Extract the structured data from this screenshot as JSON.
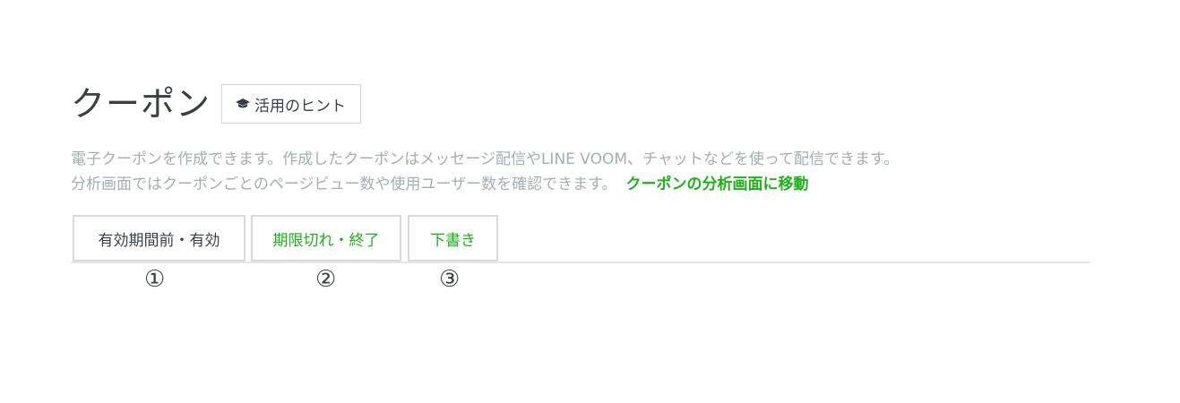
{
  "header": {
    "title": "クーポン",
    "hint_button": {
      "label": "活用のヒント",
      "icon": "graduation-cap-icon"
    }
  },
  "description": {
    "line1": "電子クーポンを作成できます。作成したクーポンはメッセージ配信やLINE VOOM、チャットなどを使って配信できます。",
    "line2": "分析画面ではクーポンごとのページビュー数や使用ユーザー数を確認できます。",
    "link": "クーポンの分析画面に移動"
  },
  "tabs": [
    {
      "label": "有効期間前・有効"
    },
    {
      "label": "期限切れ・終了"
    },
    {
      "label": "下書き"
    }
  ],
  "annotations": [
    "①",
    "②",
    "③"
  ],
  "colors": {
    "accent_green": "#1cb317",
    "text_dark": "#3a3e45",
    "text_muted": "#a7adb4",
    "border": "#d8dadd"
  }
}
